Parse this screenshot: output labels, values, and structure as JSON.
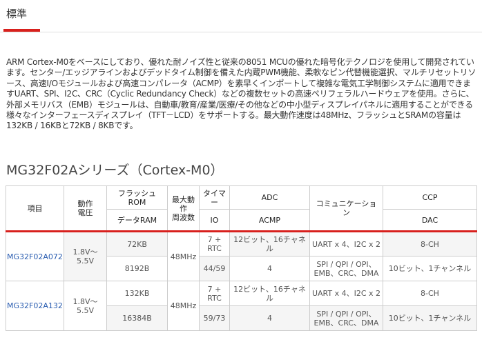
{
  "tab": {
    "label": "標準"
  },
  "description": "ARM Cortex-M0をベースにしており、優れた耐ノイズ性と従来の8051 MCUの優れた暗号化テクノロジを使用して開発されています。センター/エッジアラインおよびデッドタイム制御を備えた内蔵PWM機能、柔軟なピン代替機能選択、マルチリセットリソース、高速I/Oモジュールおよび高速コンパレータ（ACMP）を素早くインポートして複雑な電気工学制御システムに適用できますUART、SPI、I2C、CRC（Cyclic Redundancy Check）などの複数セットの高速ペリフェラルハードウェアを使用。さらに、外部メモリバス（EMB）モジュールは、自動車/教育/産業/医療/その他などの中小型ディスプレイパネルに適用することができる様々なインターフェースディスプレイ（TFT－LCD）をサポートする。最大動作速度は48MHz、フラッシュとSRAMの容量は132KB / 16KBと72KB / 8KBです。",
  "section_title": "MG32F02Aシリーズ（Cortex-M0）",
  "table": {
    "headers": {
      "item": "項目",
      "voltage": "動作\n電圧",
      "flash_rom": "フラッシュ\nROM",
      "max_freq": "最大動\n作\n周波数",
      "timer": "タイマ\nー",
      "adc": "ADC",
      "comm": "コミュニケーショ\nン",
      "ccp": "CCP",
      "data_ram": "データRAM",
      "io": "IO",
      "acmp": "ACMP",
      "dac": "DAC"
    },
    "rows": [
      {
        "model": "MG32F02A072",
        "voltage": "1.8V～5.5V",
        "flash": "72KB",
        "ram": "8192B",
        "freq": "48MHz",
        "timer": "7 + RTC",
        "io": "44/59",
        "adc": "12ビット、16チャネル",
        "acmp": "4",
        "comm1": "UART x 4、I2C x 2",
        "comm2": "SPI / QPI / OPI、EMB、CRC、DMA",
        "ccp": "8-CH",
        "dac": "10ビット、1チャンネル"
      },
      {
        "model": "MG32F02A132",
        "voltage": "1.8V～\n5.5V",
        "flash": "132KB",
        "ram": "16384B",
        "freq": "48MHz",
        "timer": "7 + RTC",
        "io": "59/73",
        "adc": "12ビット、16チャネル",
        "acmp": "4",
        "comm1": "UART x 4、I2C x 2",
        "comm2": "SPI / QPI / OPI、EMB、CRC、DMA",
        "ccp": "8-CH",
        "dac": "10ビット、1チャンネル"
      }
    ]
  }
}
